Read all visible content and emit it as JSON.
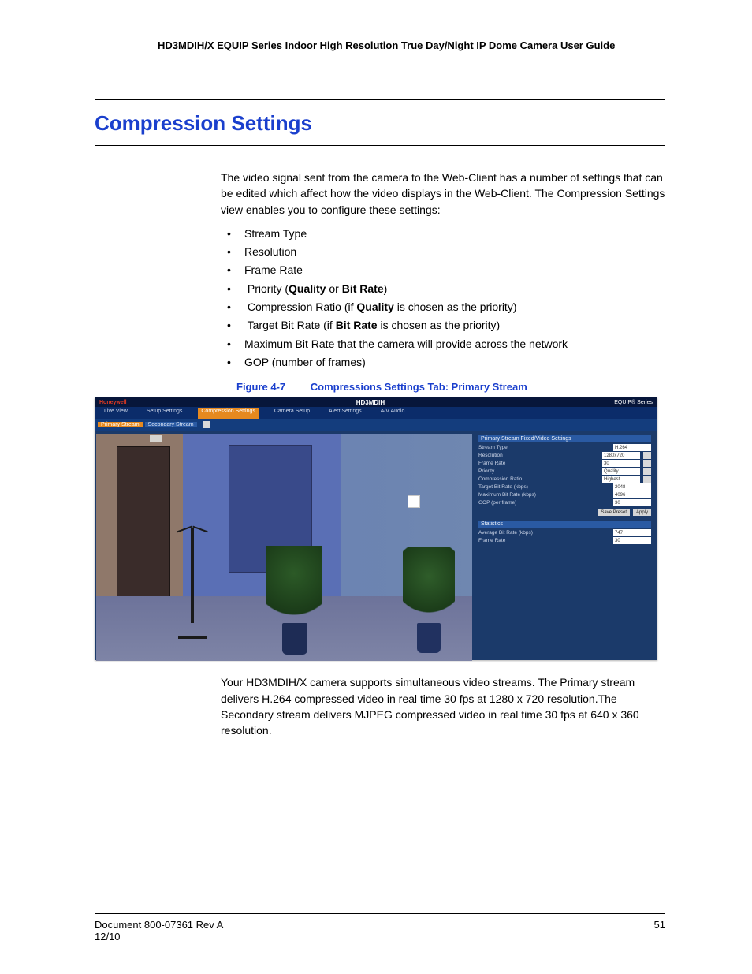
{
  "header": "HD3MDIH/X EQUIP Series Indoor High Resolution True Day/Night IP Dome Camera User Guide",
  "title": "Compression Settings",
  "intro": "The video signal sent from the camera to the Web-Client has a number of settings that can be edited which affect how the video displays in the Web-Client. The Compression Settings view enables you to configure these settings:",
  "bullets": {
    "b0": "Stream Type",
    "b1": "Resolution",
    "b2": "Frame Rate",
    "b3_pre": "Priority (",
    "b3_q": "Quality",
    "b3_or": " or ",
    "b3_b": "Bit Rate",
    "b3_post": ")",
    "b4_pre": "Compression Ratio (if ",
    "b4_q": "Quality",
    "b4_post": " is chosen as the priority)",
    "b5_pre": "Target Bit Rate (if ",
    "b5_b": "Bit Rate",
    "b5_post": " is chosen as the priority)",
    "b6": "Maximum Bit Rate that the camera will provide across the network",
    "b7": "GOP (number of frames)"
  },
  "figure": {
    "num": "Figure 4-7",
    "caption": "Compressions Settings Tab: Primary Stream"
  },
  "screenshot": {
    "brand": "Honeywell",
    "model": "HD3MDIH",
    "equip": "EQUIP® Series",
    "tabs": {
      "t0": "Live View",
      "t1": "Setup Settings",
      "t2": "Compression Settings",
      "t3": "Camera Setup",
      "t4": "Alert Settings",
      "t5": "A/V Audio"
    },
    "subtabs": {
      "s0": "Primary Stream",
      "s1": "Secondary Stream"
    },
    "panel_hdr": "Primary Stream Fixed/Video Settings",
    "rows": {
      "r0l": "Stream Type",
      "r0v": "H.264",
      "r1l": "Resolution",
      "r1v": "1280x720",
      "r2l": "Frame Rate",
      "r2v": "30",
      "r3l": "Priority",
      "r3v": "Quality",
      "r4l": "Compression Ratio",
      "r4v": "Highest",
      "r5l": "Target Bit Rate (kbps)",
      "r5v": "2048",
      "r6l": "Maximum Bit Rate (kbps)",
      "r6v": "4096",
      "r7l": "GOP (per frame)",
      "r7v": "30"
    },
    "btn_save": "Save Preset",
    "btn_apply": "Apply",
    "stats_hdr": "Statistics",
    "stats_r1l": "Average Bit Rate (kbps)",
    "stats_r1v": "747",
    "stats_r2l": "Frame Rate",
    "stats_r2v": "30"
  },
  "para2": "Your HD3MDIH/X camera supports simultaneous video streams. The Primary stream delivers H.264 compressed video in real time 30 fps at 1280 x 720 resolution.The Secondary stream delivers MJPEG compressed video in real time 30 fps at 640 x 360 resolution.",
  "footer": {
    "doc": "Document 800-07361 Rev A",
    "date": "12/10",
    "page": "51"
  }
}
